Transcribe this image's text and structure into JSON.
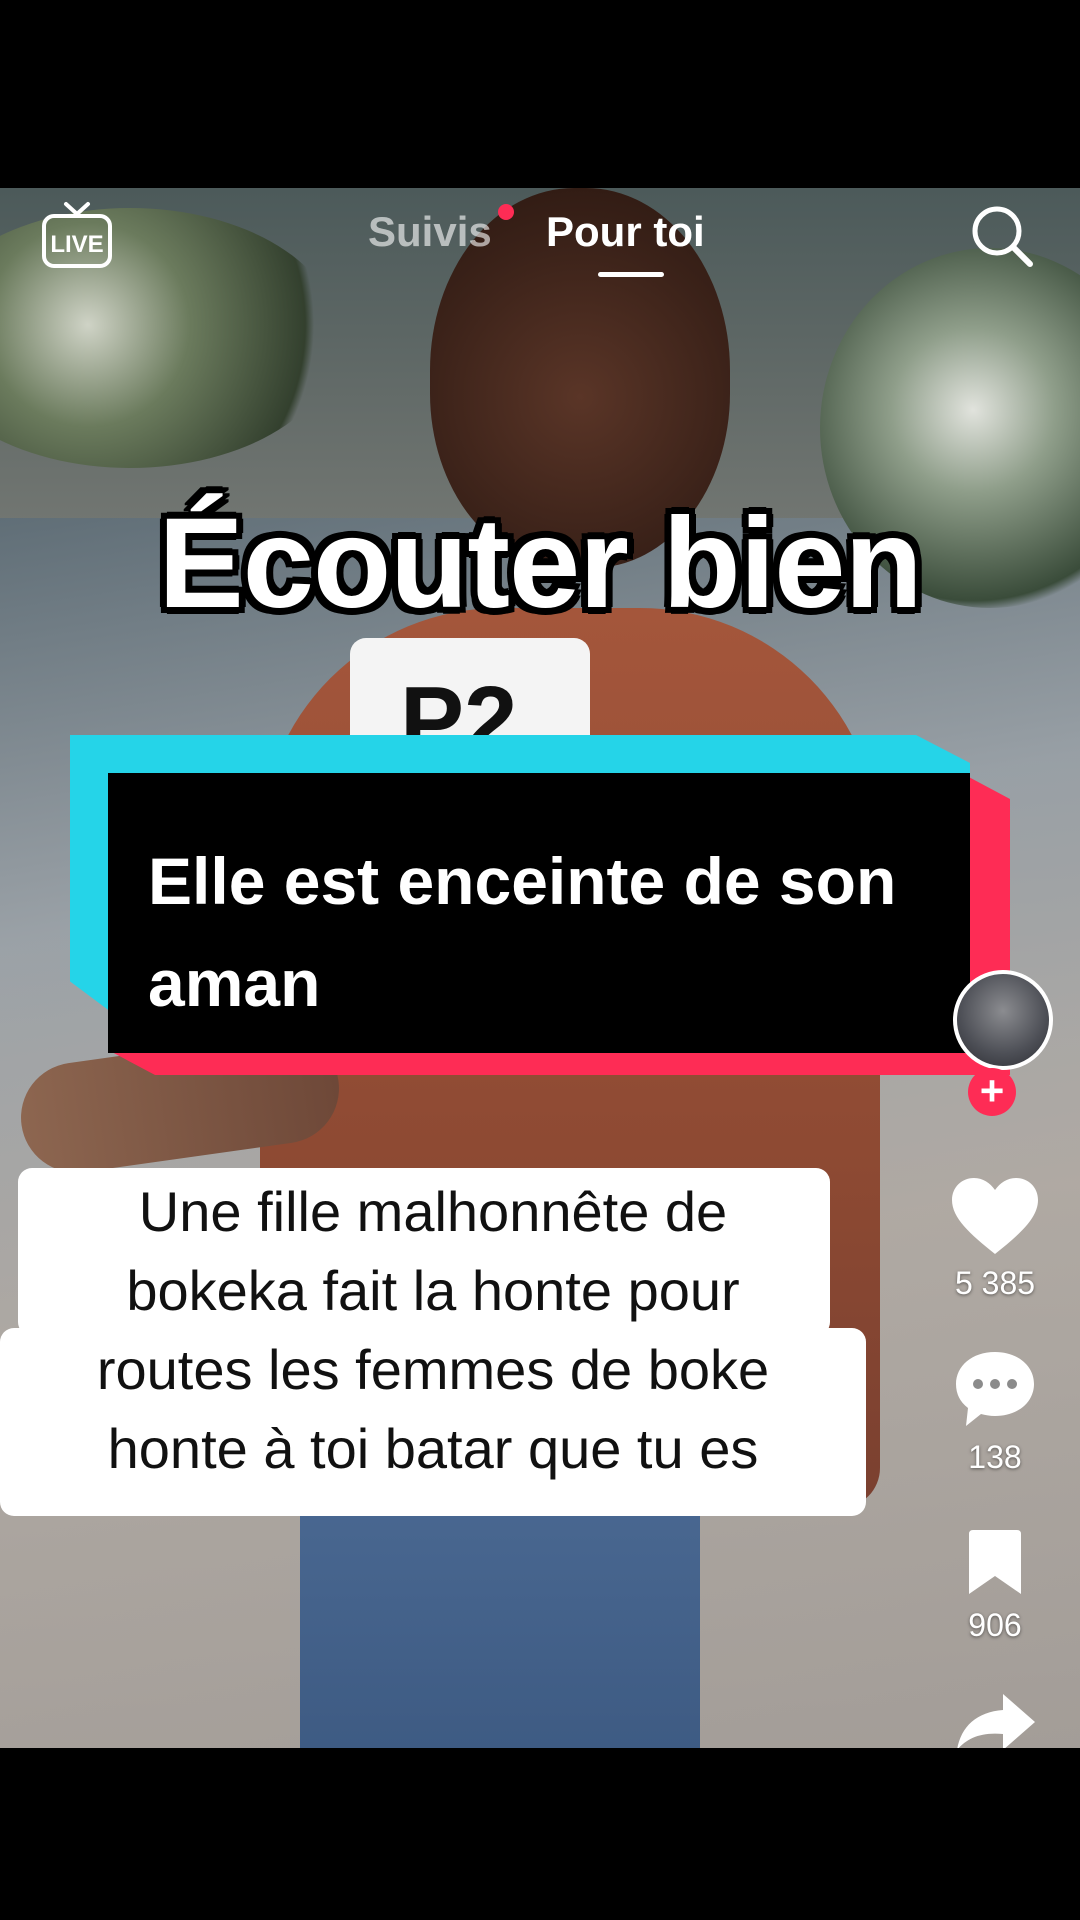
{
  "top_nav": {
    "live_label": "LIVE",
    "tabs": [
      {
        "label": "Suivis",
        "active": false,
        "notification_dot": true
      },
      {
        "label": "Pour toi",
        "active": true
      }
    ]
  },
  "video": {
    "headline": "Écouter bien",
    "sign_text": "P2",
    "caption": "Elle est enceinte de son aman",
    "comment_lines": [
      "Une fille malhonnête de",
      "bokeka fait la honte pour",
      "routes  les femmes de boke",
      "honte à toi batar que tu es"
    ]
  },
  "actions": {
    "likes": "5 385",
    "comments": "138",
    "saves": "906"
  },
  "colors": {
    "accent_red": "#fe2c55",
    "accent_cyan": "#25d4e8"
  },
  "icons": [
    "live-tv-icon",
    "search-icon",
    "heart-icon",
    "comment-icon",
    "bookmark-icon",
    "share-icon",
    "plus-icon"
  ]
}
